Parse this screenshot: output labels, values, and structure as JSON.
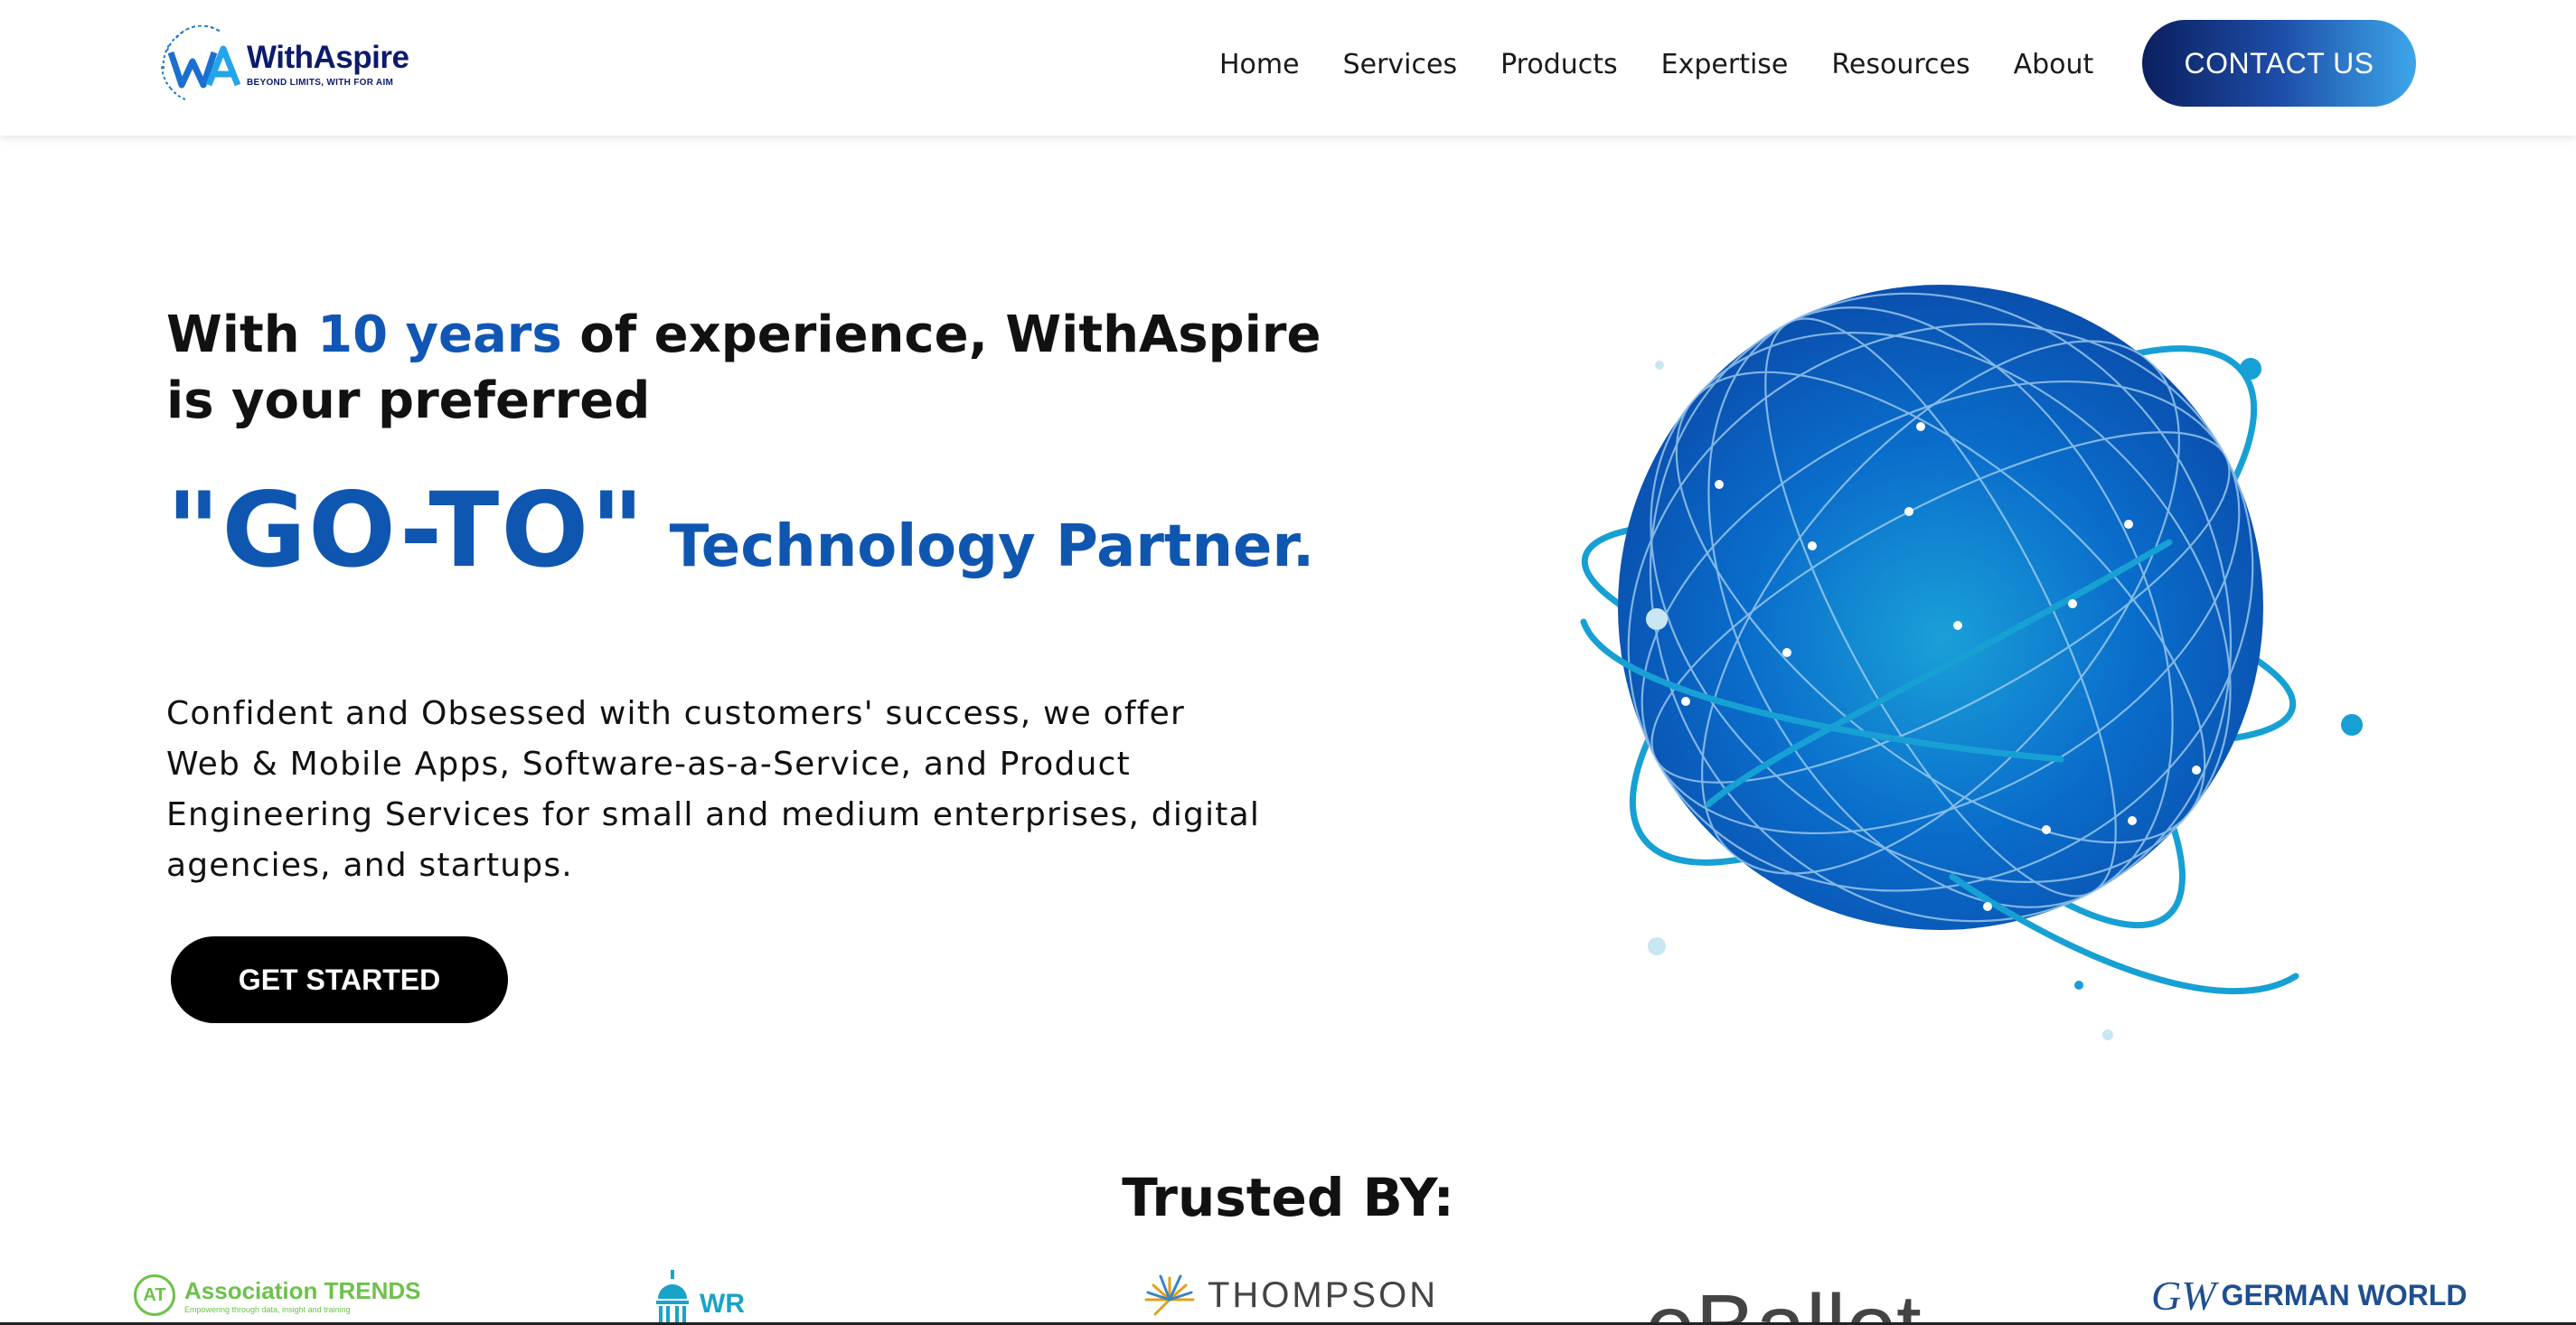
{
  "brand": {
    "name": "WithAspire",
    "tagline": "BEYOND LIMITS, WITH FOR AIM",
    "logo_letters": "WA",
    "colors": {
      "navy": "#0c1b6b",
      "accent": "#1156b4",
      "globe": "#0a5bbf",
      "orbit": "#19a0d6"
    }
  },
  "nav": {
    "items": [
      {
        "label": "Home"
      },
      {
        "label": "Services"
      },
      {
        "label": "Products"
      },
      {
        "label": "Expertise"
      },
      {
        "label": "Resources"
      },
      {
        "label": "About"
      }
    ],
    "contact_label": "CONTACT US"
  },
  "hero": {
    "prefix": "With ",
    "highlight": "10 years",
    "suffix": " of experience, WithAspire is your preferred",
    "goto": "\"GO-TO\"",
    "tech": "Technology Partner.",
    "description": "Confident and Obsessed with customers' success, we offer Web & Mobile Apps, Software-as-a-Service, and Product Engineering Services for small and medium enterprises, digital agencies, and startups.",
    "cta": "GET STARTED",
    "illustration_icon": "globe-network-icon"
  },
  "trusted": {
    "title": "Trusted BY:",
    "clients": [
      {
        "name": "Association TRENDS",
        "mark": "AT",
        "sub": "Empowering through data, insight and training",
        "icon": "association-trends-logo"
      },
      {
        "name": "WR",
        "icon": "capitol-dome-icon"
      },
      {
        "name": "THOMPSON",
        "icon": "starburst-icon"
      },
      {
        "name": "eBallot",
        "icon": "eballot-logo"
      },
      {
        "name": "GERMAN WORLD",
        "mark": "GW",
        "icon": "german-world-logo"
      }
    ]
  }
}
